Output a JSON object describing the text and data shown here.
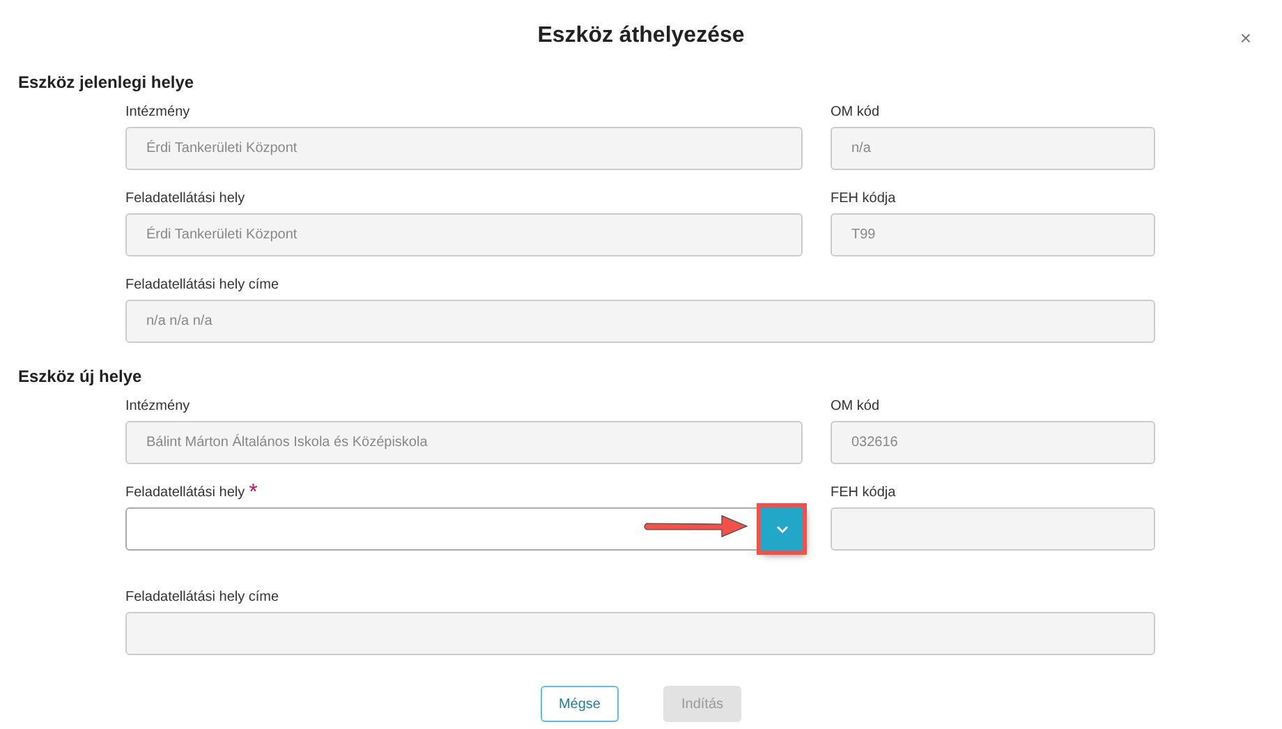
{
  "window": {
    "title": "Eszköz áthelyezése",
    "close": "×"
  },
  "sections": [
    {
      "heading": "Eszköz jelenlegi helye",
      "rows": [
        [
          {
            "kind": "text",
            "label": "Intézmény",
            "value": "Érdi Tankerületi Központ",
            "disabled": true
          },
          {
            "kind": "text",
            "label": "OM kód",
            "value": "n/a",
            "disabled": true
          }
        ],
        [
          {
            "kind": "text",
            "label": "Feladatellátási hely",
            "value": "Érdi Tankerületi Központ",
            "disabled": true
          },
          {
            "kind": "text",
            "label": "FEH kódja",
            "value": "T99",
            "disabled": true
          }
        ],
        [
          {
            "kind": "text",
            "label": "Feladatellátási hely címe",
            "value": "n/a n/a n/a",
            "disabled": true
          }
        ]
      ]
    },
    {
      "heading": "Eszköz új helye",
      "rows": [
        [
          {
            "kind": "text",
            "label": "Intézmény",
            "value": "Bálint Márton Általános Iskola és Középiskola",
            "disabled": true
          },
          {
            "kind": "text",
            "label": "OM kód",
            "value": "032616",
            "disabled": true
          }
        ],
        [
          {
            "kind": "select",
            "label": "Feladatellátási hely",
            "required_mark": "*",
            "disabled": false,
            "highlighted": true
          },
          {
            "kind": "text",
            "label": "FEH kódja",
            "disabled": true
          }
        ],
        [
          {
            "kind": "text",
            "label": "Feladatellátási hely címe",
            "disabled": true
          }
        ]
      ]
    }
  ],
  "buttons": [
    {
      "kind": "secondary",
      "label": "Mégse",
      "disabled": false
    },
    {
      "kind": "primary",
      "label": "Indítás",
      "disabled": true
    }
  ]
}
